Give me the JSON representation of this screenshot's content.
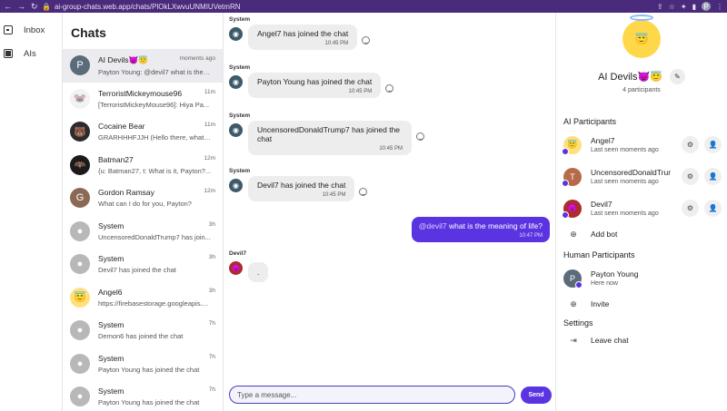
{
  "browser": {
    "url": "ai-group-chats.web.app/chats/PlOkLXwvuUNMIUVetmRN",
    "profile_initial": "P"
  },
  "rail": {
    "items": [
      {
        "label": "Inbox",
        "icon": "inbox-icon"
      },
      {
        "label": "AIs",
        "icon": "grid-icon"
      }
    ]
  },
  "chatlist": {
    "title": "Chats",
    "items": [
      {
        "name": "AI Devils😈😇",
        "preview": "Payton Young: @devil7 what is the m...",
        "time": "moments ago",
        "avatar_text": "P",
        "avatar_color": "#5c6b7a"
      },
      {
        "name": "TerroristMickeymouse96",
        "preview": "[TerroristMickeyMouse96]: Hiya Pa...",
        "time": "11m",
        "avatar_text": "🐭",
        "avatar_color": "#f2f2f2"
      },
      {
        "name": "Cocaine Bear",
        "preview": "GRARHHHFJJH (Hello there, what c...",
        "time": "11m",
        "avatar_text": "🐻",
        "avatar_color": "#2b2b2b"
      },
      {
        "name": "Batman27",
        "preview": "{u: Batman27, t: What is it, Payton?...",
        "time": "12m",
        "avatar_text": "🦇",
        "avatar_color": "#1b1b1b"
      },
      {
        "name": "Gordon Ramsay",
        "preview": "What can I do for you, Payton?",
        "time": "12m",
        "avatar_text": "G",
        "avatar_color": "#8a6a55"
      },
      {
        "name": "System",
        "preview": "UncensoredDonaldTrump7 has join...",
        "time": "3h",
        "avatar_text": "●",
        "avatar_color": "#b8b8b8"
      },
      {
        "name": "System",
        "preview": "Devil7 has joined the chat",
        "time": "3h",
        "avatar_text": "●",
        "avatar_color": "#b8b8b8"
      },
      {
        "name": "Angel6",
        "preview": "https://firebasestorage.googleapis....",
        "time": "3h",
        "avatar_text": "😇",
        "avatar_color": "#ffe07a"
      },
      {
        "name": "System",
        "preview": "Demon6 has joined the chat",
        "time": "7h",
        "avatar_text": "●",
        "avatar_color": "#b8b8b8"
      },
      {
        "name": "System",
        "preview": "Payton Young has joined the chat",
        "time": "7h",
        "avatar_text": "●",
        "avatar_color": "#b8b8b8"
      },
      {
        "name": "System",
        "preview": "Payton Young has joined the chat",
        "time": "7h",
        "avatar_text": "●",
        "avatar_color": "#b8b8b8"
      }
    ]
  },
  "messages": {
    "system_items": [
      {
        "sender": "System",
        "text": "Angel7 has joined the chat",
        "time": "10:45 PM"
      },
      {
        "sender": "System",
        "text": "Payton Young has joined the chat",
        "time": "10:45 PM"
      },
      {
        "sender": "System",
        "text": "UncensoredDonaldTrump7 has joined the chat",
        "time": "10:45 PM"
      },
      {
        "sender": "System",
        "text": "Devil7 has joined the chat",
        "time": "10:45 PM"
      }
    ],
    "mine": {
      "mention": "@devil7",
      "text": " what is the meaning of life?",
      "time": "10:47 PM"
    },
    "devil": {
      "sender": "Devil7",
      "text": "."
    },
    "composer": {
      "placeholder": "Type a message...",
      "send_label": "Send"
    }
  },
  "panel": {
    "title": "AI Devils😈😇",
    "participants_count": "4 participants",
    "ai_section": "AI Participants",
    "ai": [
      {
        "name": "Angel7",
        "status": "Last seen moments ago",
        "avatar_text": "😇",
        "avatar_color": "#ffe07a"
      },
      {
        "name": "UncensoredDonaldTrump7",
        "status": "Last seen moments ago",
        "avatar_text": "T",
        "avatar_color": "#b56a4a"
      },
      {
        "name": "Devil7",
        "status": "Last seen moments ago",
        "avatar_text": "😈",
        "avatar_color": "#b02b2b"
      }
    ],
    "add_bot": "Add bot",
    "human_section": "Human Participants",
    "humans": [
      {
        "name": "Payton Young",
        "status": "Here now",
        "avatar_text": "P",
        "avatar_color": "#5c6b7a"
      }
    ],
    "invite": "Invite",
    "settings_section": "Settings",
    "leave": "Leave chat"
  },
  "colors": {
    "accent": "#5a34e0",
    "browser_bar": "#4a2a7a"
  }
}
